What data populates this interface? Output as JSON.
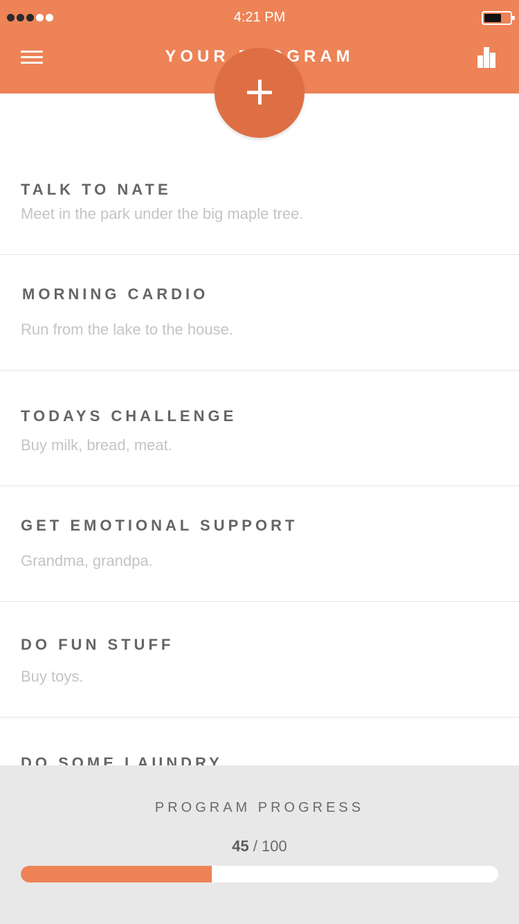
{
  "status_bar": {
    "time": "4:21 PM",
    "signal_strength": 3,
    "signal_max": 5
  },
  "header": {
    "title": "YOUR PROGRAM",
    "menu_icon": "hamburger-menu-icon",
    "stats_icon": "bar-chart-icon",
    "add_icon": "plus-icon"
  },
  "items": [
    {
      "title": "TALK TO NATE",
      "description": "Meet in the park under the big maple tree."
    },
    {
      "title": "MORNING CARDIO",
      "description": "Run from the lake to the house."
    },
    {
      "title": "TODAYS CHALLENGE",
      "description": "Buy milk, bread, meat."
    },
    {
      "title": "GET EMOTIONAL SUPPORT",
      "description": "Grandma, grandpa."
    },
    {
      "title": "DO FUN STUFF",
      "description": "Buy toys."
    },
    {
      "title": "DO SOME LAUNDRY",
      "description": ""
    }
  ],
  "progress": {
    "label": "PROGRAM PROGRESS",
    "current": "45",
    "separator": " / ",
    "max": "100",
    "fraction": 0.4
  },
  "colors": {
    "accent": "#ED8357",
    "fab": "#DE6F44",
    "title_text": "#656565",
    "description_text": "#C4C4C4",
    "panel_background": "#E8E8E8"
  }
}
